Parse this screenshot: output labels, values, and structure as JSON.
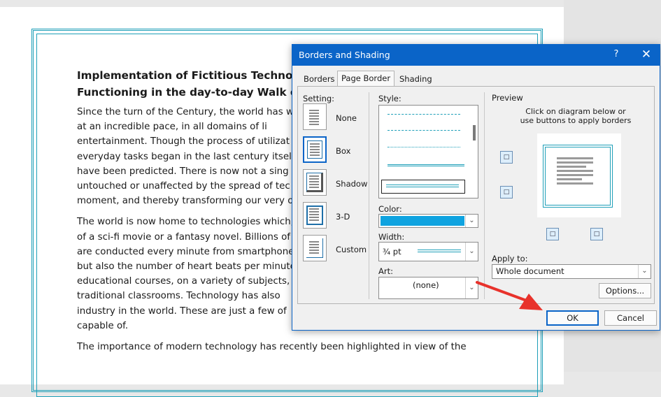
{
  "document": {
    "title": "Implementation of Fictitious Technology\nFunctioning in the day-to-day Walk of Li",
    "paragraphs": [
      "Since the turn of the Century, the world has witr\nat an incredible pace, in all domains of li\nentertainment. Though the process of utilizat\neveryday tasks began in the last century itself, t\nhave been predicted. There is now not a sing\nuntouched or unaffected by the spread of tec\nmoment, and thereby transforming our very ov",
      "The world is now home to technologies which, c\nof a sci-fi movie or a fantasy novel. Billions of\nare conducted every minute from smartphones.\nbut also the number of heart beats per minute\neducational courses, on a variety of subjects, a\ntraditional classrooms. Technology has also\nindustry in the world. These are just a few of\ncapable of.",
      "The importance of modern technology has recently been highlighted in view of the"
    ]
  },
  "dialog": {
    "title": "Borders and Shading",
    "help": "?",
    "close": "✕",
    "tabs": [
      "Borders",
      "Page Border",
      "Shading"
    ],
    "active_tab": "Page Border",
    "setting": {
      "label": "Setting:",
      "options": [
        "None",
        "Box",
        "Shadow",
        "3-D",
        "Custom"
      ],
      "selected": "Box"
    },
    "style_label": "Style:",
    "color_label": "Color:",
    "color_value": "#0fa3e0",
    "width_label": "Width:",
    "width_value": "¾ pt",
    "art_label": "Art:",
    "art_value": "(none)",
    "preview": {
      "label": "Preview",
      "hint": "Click on diagram below or\nuse buttons to apply borders"
    },
    "apply_to_label": "Apply to:",
    "apply_to_value": "Whole document",
    "options_button": "Options...",
    "ok_button": "OK",
    "cancel_button": "Cancel"
  },
  "colors": {
    "accent": "#0a64c8",
    "page_border": "#1e9fb8",
    "arrow": "#e8322b"
  }
}
